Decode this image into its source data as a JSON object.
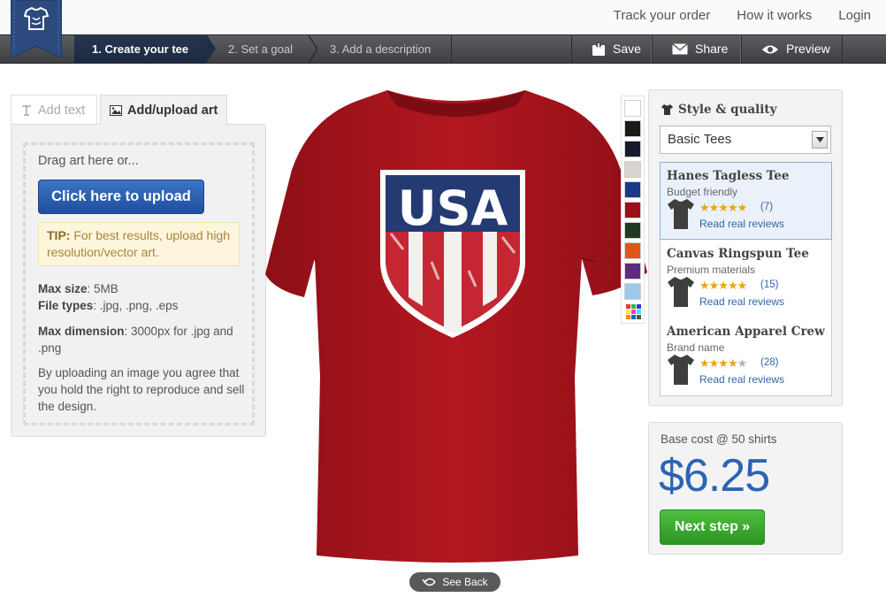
{
  "header": {
    "links": [
      "Track your order",
      "How it works",
      "Login"
    ]
  },
  "steps": [
    {
      "label": "1. Create your tee",
      "active": true
    },
    {
      "label": "2. Set a goal",
      "active": false
    },
    {
      "label": "3. Add a description",
      "active": false
    }
  ],
  "actions": {
    "save": "Save",
    "share": "Share",
    "preview": "Preview"
  },
  "tabs": {
    "add_text": "Add text",
    "upload_art": "Add/upload art"
  },
  "upload": {
    "drag_label": "Drag art here or...",
    "button": "Click here to upload",
    "tip_label": "TIP:",
    "tip_text": "For best results, upload high resolution/vector art.",
    "max_size_label": "Max size",
    "max_size_value": ": 5MB",
    "file_types_label": "File types",
    "file_types_value": ": .jpg, .png, .eps",
    "max_dim_label": "Max dimension",
    "max_dim_value": ": 3000px for .jpg and .png",
    "legal": "By uploading an image you agree that you hold the right to reproduce and sell the design."
  },
  "design": {
    "text": "USA",
    "shirt_color": "#a8151d"
  },
  "colors": [
    "#ffffff",
    "#1a1a1a",
    "#151a2e",
    "#d8d3cc",
    "#1b3a86",
    "#9c0f1a",
    "#1f3a1e",
    "#e0561a",
    "#5b2c7f",
    "#9cc9ea"
  ],
  "style": {
    "heading": "Style & quality",
    "selected": "Basic Tees",
    "products": [
      {
        "name": "Hanes Tagless Tee",
        "sub": "Budget friendly",
        "rating": 5,
        "count": "(7)",
        "link": "Read real reviews",
        "selected": true
      },
      {
        "name": "Canvas Ringspun Tee",
        "sub": "Premium materials",
        "rating": 5,
        "count": "(15)",
        "link": "Read real reviews",
        "selected": false
      },
      {
        "name": "American Apparel Crew",
        "sub": "Brand name",
        "rating": 4,
        "count": "(28)",
        "link": "Read real reviews",
        "selected": false
      }
    ]
  },
  "cost": {
    "label": "Base cost @ 50 shirts",
    "value": "$6.25",
    "next": "Next step »"
  },
  "see_back": "See Back"
}
